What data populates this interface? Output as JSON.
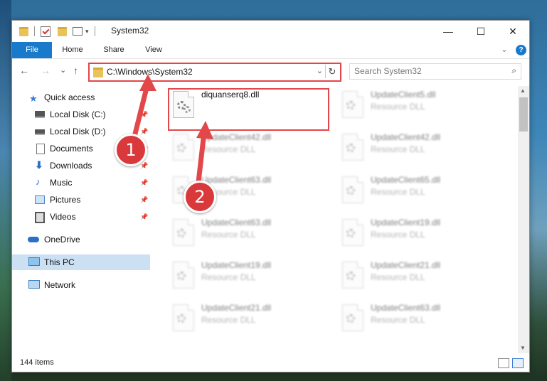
{
  "window": {
    "title": "System32"
  },
  "caption": {
    "minimize": "—",
    "maximize": "☐",
    "close": "✕"
  },
  "ribbon": {
    "tabs": [
      "File",
      "Home",
      "Share",
      "View"
    ],
    "expand": "⌄",
    "help": "?"
  },
  "nav_buttons": {
    "back": "←",
    "forward": "→",
    "recent": "⌄",
    "up": "↑"
  },
  "address": {
    "path": "C:\\Windows\\System32",
    "dropdown": "⌄",
    "refresh": "↻"
  },
  "search": {
    "placeholder": "Search System32",
    "icon": "⌕"
  },
  "sidebar": {
    "items": [
      {
        "label": "Quick access",
        "icon": "star-icon",
        "pinned": false
      },
      {
        "label": "Local Disk (C:)",
        "icon": "drive-icon",
        "pinned": true
      },
      {
        "label": "Local Disk (D:)",
        "icon": "drive-icon",
        "pinned": true
      },
      {
        "label": "Documents",
        "icon": "document-icon",
        "pinned": true
      },
      {
        "label": "Downloads",
        "icon": "download-icon",
        "pinned": true
      },
      {
        "label": "Music",
        "icon": "music-icon",
        "pinned": true
      },
      {
        "label": "Pictures",
        "icon": "pictures-icon",
        "pinned": true
      },
      {
        "label": "Videos",
        "icon": "videos-icon",
        "pinned": true
      },
      {
        "label": "OneDrive",
        "icon": "cloud-icon",
        "pinned": false
      },
      {
        "label": "This PC",
        "icon": "computer-icon",
        "pinned": false,
        "selected": true
      },
      {
        "label": "Network",
        "icon": "network-icon",
        "pinned": false
      }
    ],
    "pin_glyph": "📌"
  },
  "files": [
    {
      "name": "diquanserq8.dll",
      "type": "",
      "highlighted": true
    },
    {
      "name": "UpdateClient5.dll",
      "type": "Resource DLL"
    },
    {
      "name": "UpdateClient42.dll",
      "type": "Resource DLL"
    },
    {
      "name": "UpdateClient42.dll",
      "type": "Resource DLL"
    },
    {
      "name": "UpdateClient63.dll",
      "type": "Resource DLL"
    },
    {
      "name": "UpdateClient65.dll",
      "type": "Resource DLL"
    },
    {
      "name": "UpdateClient63.dll",
      "type": "Resource DLL"
    },
    {
      "name": "UpdateClient19.dll",
      "type": "Resource DLL"
    },
    {
      "name": "UpdateClient19.dll",
      "type": "Resource DLL"
    },
    {
      "name": "UpdateClient21.dll",
      "type": "Resource DLL"
    },
    {
      "name": "UpdateClient21.dll",
      "type": "Resource DLL"
    },
    {
      "name": "UpdateClient63.dll",
      "type": "Resource DLL"
    }
  ],
  "status": {
    "item_count": "144 items"
  },
  "annotations": {
    "step1": "1",
    "step2": "2",
    "color": "#e2474a"
  }
}
